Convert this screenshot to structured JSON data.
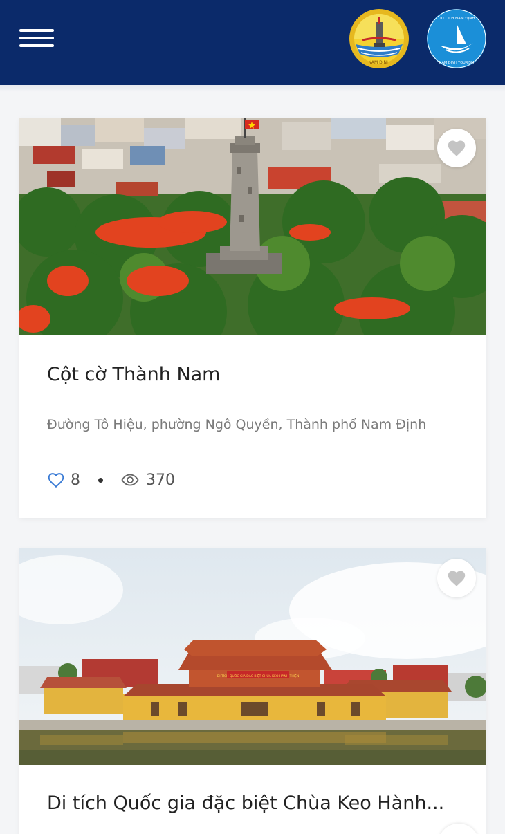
{
  "header": {
    "menu_icon": "hamburger-menu-icon",
    "logo_left": "nam-dinh-emblem-logo",
    "logo_right": "nam-dinh-tourism-logo",
    "logo_right_text_top": "DU LỊCH NAM ĐỊNH",
    "logo_right_text_bottom": "NAM DINH TOURISM",
    "logo_left_text": "NAM ĐỊNH"
  },
  "places": [
    {
      "title": "Cột cờ Thành Nam",
      "address": "Đường Tô Hiệu, phường Ngô Quyền, Thành phố Nam Định",
      "likes": "8",
      "views": "370",
      "like_icon": "heart-outline-icon",
      "views_icon": "eye-icon",
      "favorite_icon": "heart-icon"
    },
    {
      "title": "Di tích Quốc gia đặc biệt Chùa Keo Hành...",
      "temple_sign": "DI TÍCH QUỐC GIA ĐẶC BIỆT CHÙA KEO HÀNH THIỆN",
      "favorite_icon": "heart-icon"
    }
  ],
  "colors": {
    "header_bg": "#0b2a6a",
    "like_icon": "#3a7bd5"
  }
}
